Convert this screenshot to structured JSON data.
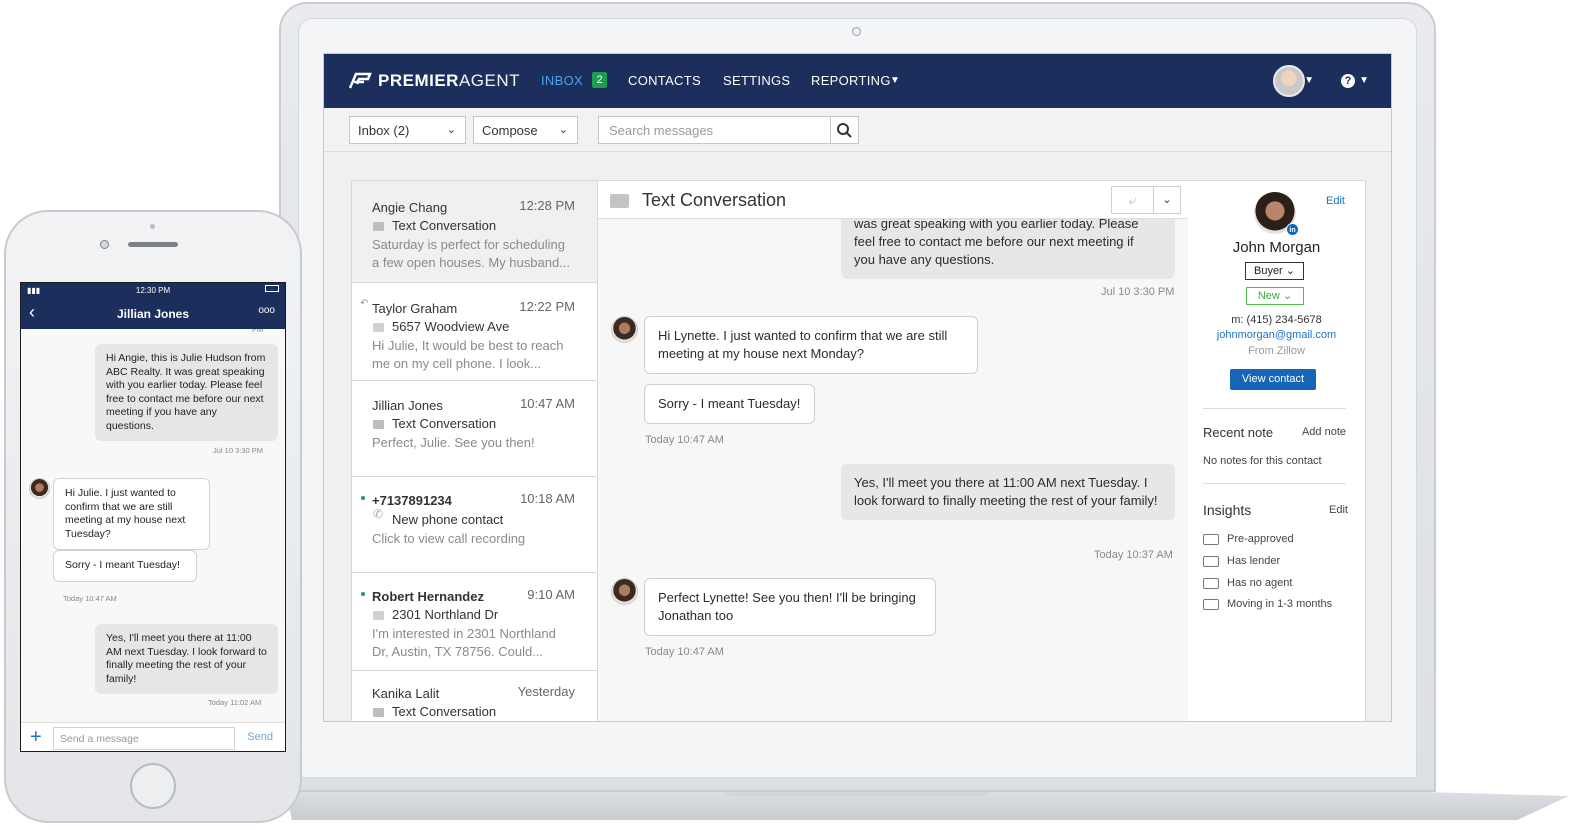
{
  "nav": {
    "brand_bold": "PREMIER",
    "brand_thin": "AGENT",
    "inbox": "INBOX",
    "inbox_count": "2",
    "contacts": "CONTACTS",
    "settings": "SETTINGS",
    "reporting": "REPORTING",
    "help": "?",
    "accent_color": "#1c2e5b"
  },
  "toolbar": {
    "inbox_filter": "Inbox (2)",
    "compose": "Compose",
    "search_placeholder": "Search messages"
  },
  "messages": [
    {
      "name": "Angie Chang",
      "time": "12:28 PM",
      "subject": "Text Conversation",
      "preview_1": "Saturday is perfect for scheduling",
      "preview_2": "a few open houses. My husband..."
    },
    {
      "name": "Taylor Graham",
      "time": "12:22 PM",
      "subject": "5657 Woodview Ave",
      "preview_1": "Hi Julie, It would be best to reach",
      "preview_2": "me on my cell phone. I look..."
    },
    {
      "name": "Jillian Jones",
      "time": "10:47 AM",
      "subject": "Text Conversation",
      "preview_1": "Perfect, Julie. See you then!",
      "preview_2": ""
    },
    {
      "name": "+7137891234",
      "time": "10:18 AM",
      "subject": "New phone contact",
      "preview_1": "Click to view call recording",
      "preview_2": ""
    },
    {
      "name": "Robert Hernandez",
      "time": "9:10 AM",
      "subject": "2301 Northland Dr",
      "preview_1": "I'm interested in 2301 Northland",
      "preview_2": "Dr, Austin, TX 78756. Could..."
    },
    {
      "name": "Kanika Lalit",
      "time": "Yesterday",
      "subject": "Text Conversation",
      "preview_1": "",
      "preview_2": ""
    }
  ],
  "conversation": {
    "title": "Text Conversation",
    "msg1_line1": "was great speaking with you earlier today. Please",
    "msg1_line2": "feel free to contact me before our next meeting if",
    "msg1_line3": "you have any questions.",
    "stamp1": "Jul 10 3:30 PM",
    "msg2": "Hi Lynette. I just wanted to confirm that we are still meeting at my house next Monday?",
    "msg3": "Sorry - I meant Tuesday!",
    "stamp2": "Today 10:47 AM",
    "msg4": "Yes, I'll meet you there at 11:00 AM next Tuesday. I look forward to finally meeting the rest of your family!",
    "stamp3": "Today 10:37 AM",
    "msg5": "Perfect Lynette! See you then! I'll be bringing Jonathan too",
    "stamp4": "Today 10:47 AM"
  },
  "contact": {
    "edit": "Edit",
    "linkedin": "in",
    "name": "John Morgan",
    "type": "Buyer",
    "status": "New",
    "phone": "m: (415) 234-5678",
    "email": "johnmorgan@gmail.com",
    "source": "From Zillow",
    "view_button": "View contact",
    "recent_note": "Recent note",
    "add_note": "Add note",
    "no_notes": "No notes for this contact",
    "insights": "Insights",
    "insights_edit": "Edit",
    "insight_items": [
      "Pre-approved",
      "Has lender",
      "Has no agent",
      "Moving in 1-3 months"
    ]
  },
  "phone": {
    "status_time": "12:30 PM",
    "title": "Jillian Jones",
    "more": "ooo",
    "cut_stamp": "PM",
    "msg1": "Hi Angie, this is Julie Hudson from ABC Realty. It was great speaking with you earlier today. Please feel free to contact me before our next meeting if you have any questions.",
    "stamp1": "Jul 10 3:30 PM",
    "msg2": "Hi Julie. I just wanted to confirm that we are still meeting at my house next Tuesday?",
    "msg3": "Sorry - I meant Tuesday!",
    "stamp2": "Today 10:47 AM",
    "msg4": "Yes, I'll meet you there at 11:00 AM next Tuesday. I look forward to finally meeting the rest of your family!",
    "stamp3": "Today 11:02 AM",
    "input_placeholder": "Send a message",
    "send": "Send"
  }
}
